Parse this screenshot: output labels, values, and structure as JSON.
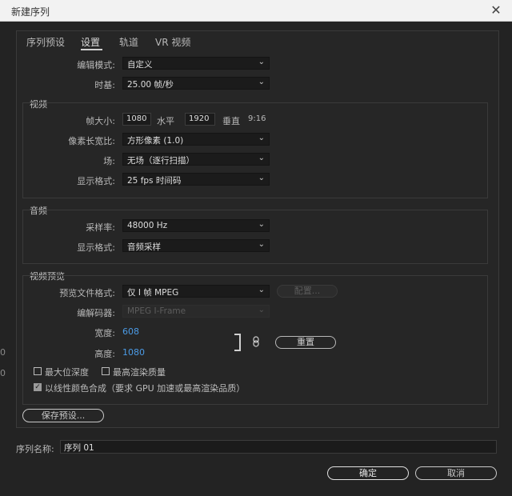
{
  "window": {
    "title": "新建序列",
    "close_glyph": "✕"
  },
  "tabs": [
    "序列预设",
    "设置",
    "轨道",
    "VR 视频"
  ],
  "edit_mode": {
    "label": "编辑模式:",
    "value": "自定义"
  },
  "timebase": {
    "label": "时基:",
    "value": "25.00  帧/秒"
  },
  "video": {
    "title": "视频",
    "frame_size_label": "帧大小:",
    "frame_w": "1080",
    "horizontal_label": "水平",
    "frame_h": "1920",
    "vertical_label": "垂直",
    "aspect": "9:16",
    "pixel_aspect_label": "像素长宽比:",
    "pixel_aspect": "方形像素 (1.0)",
    "fields_label": "场:",
    "fields": "无场（逐行扫描）",
    "display_format_label": "显示格式:",
    "display_format": "25 fps 时间码"
  },
  "audio": {
    "title": "音频",
    "sample_rate_label": "采样率:",
    "sample_rate": "48000 Hz",
    "display_format_label": "显示格式:",
    "display_format": "音频采样"
  },
  "preview": {
    "title": "视频预览",
    "file_format_label": "预览文件格式:",
    "file_format": "仅 I 帧 MPEG",
    "configure": "配置...",
    "codec_label": "编解码器:",
    "codec": "MPEG I-Frame",
    "width_label": "宽度:",
    "width": "608",
    "height_label": "高度:",
    "height": "1080",
    "reset": "重置"
  },
  "checkboxes": {
    "max_bit_depth": "最大位深度",
    "max_render_quality": "最高渲染质量",
    "linear_color": "以线性颜色合成（要求 GPU 加速或最高渲染品质）"
  },
  "save_preset": "保存预设...",
  "sequence_name": {
    "label": "序列名称:",
    "value": "序列 01"
  },
  "buttons": {
    "ok": "确定",
    "cancel": "取消"
  },
  "icons": {
    "caret": "⌄",
    "check": "✓",
    "link": "🔗"
  },
  "edge_glyphs": [
    "0",
    "0"
  ]
}
